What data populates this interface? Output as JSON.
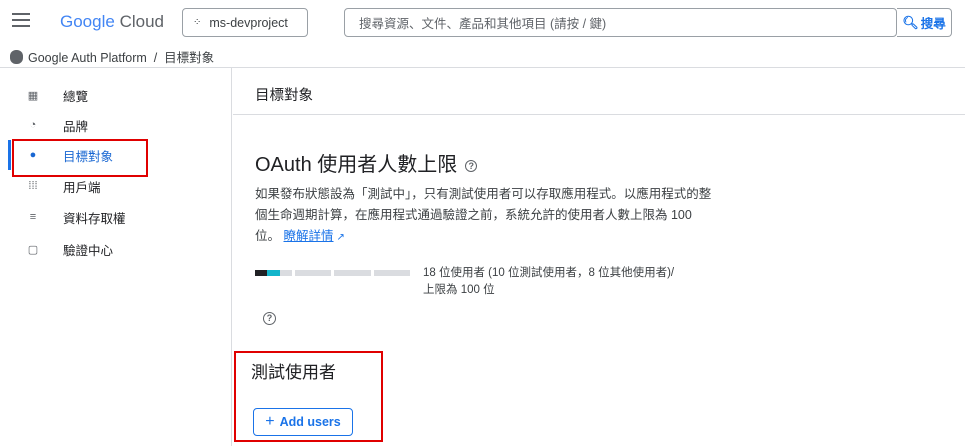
{
  "header": {
    "logo_google": "Google",
    "logo_cloud": "Cloud",
    "project_name": "ms-devproject",
    "search_placeholder": "搜尋資源、文件、產品和其他項目 (請按 / 鍵)",
    "search_button": "搜尋"
  },
  "breadcrumb": {
    "text": "Google Auth Platform  /  目標對象"
  },
  "sidebar": {
    "items": [
      {
        "label": "總覽",
        "icon": "dashboard-icon"
      },
      {
        "label": "品牌",
        "icon": "palette-icon"
      },
      {
        "label": "目標對象",
        "icon": "account-circle-icon"
      },
      {
        "label": "用戶端",
        "icon": "apps-icon"
      },
      {
        "label": "資料存取權",
        "icon": "data-access-icon"
      },
      {
        "label": "驗證中心",
        "icon": "verification-icon"
      }
    ],
    "active_index": 2
  },
  "main": {
    "title": "目標對象",
    "section_title": "OAuth 使用者人數上限",
    "desc_before": "如果發布狀態設為「測試中」，只有測試使用者可以存取應用程式。以應用程式的整個生命週期計算，在應用程式通過驗證之前，系統允許的使用者人數上限為 100 位。",
    "desc_link": "瞭解詳情",
    "usage_line1": "18 位使用者 (10 位測試使用者，8 位其他使用者)/",
    "usage_line2": "上限為 100 位",
    "usage_fraction": 0.18,
    "test_users_title": "測試使用者",
    "add_users_label": "Add users"
  },
  "colors": {
    "accent": "#1a73e8",
    "highlight_box": "#e00000",
    "progress_test": "#202124",
    "progress_other": "#12b5cb"
  }
}
